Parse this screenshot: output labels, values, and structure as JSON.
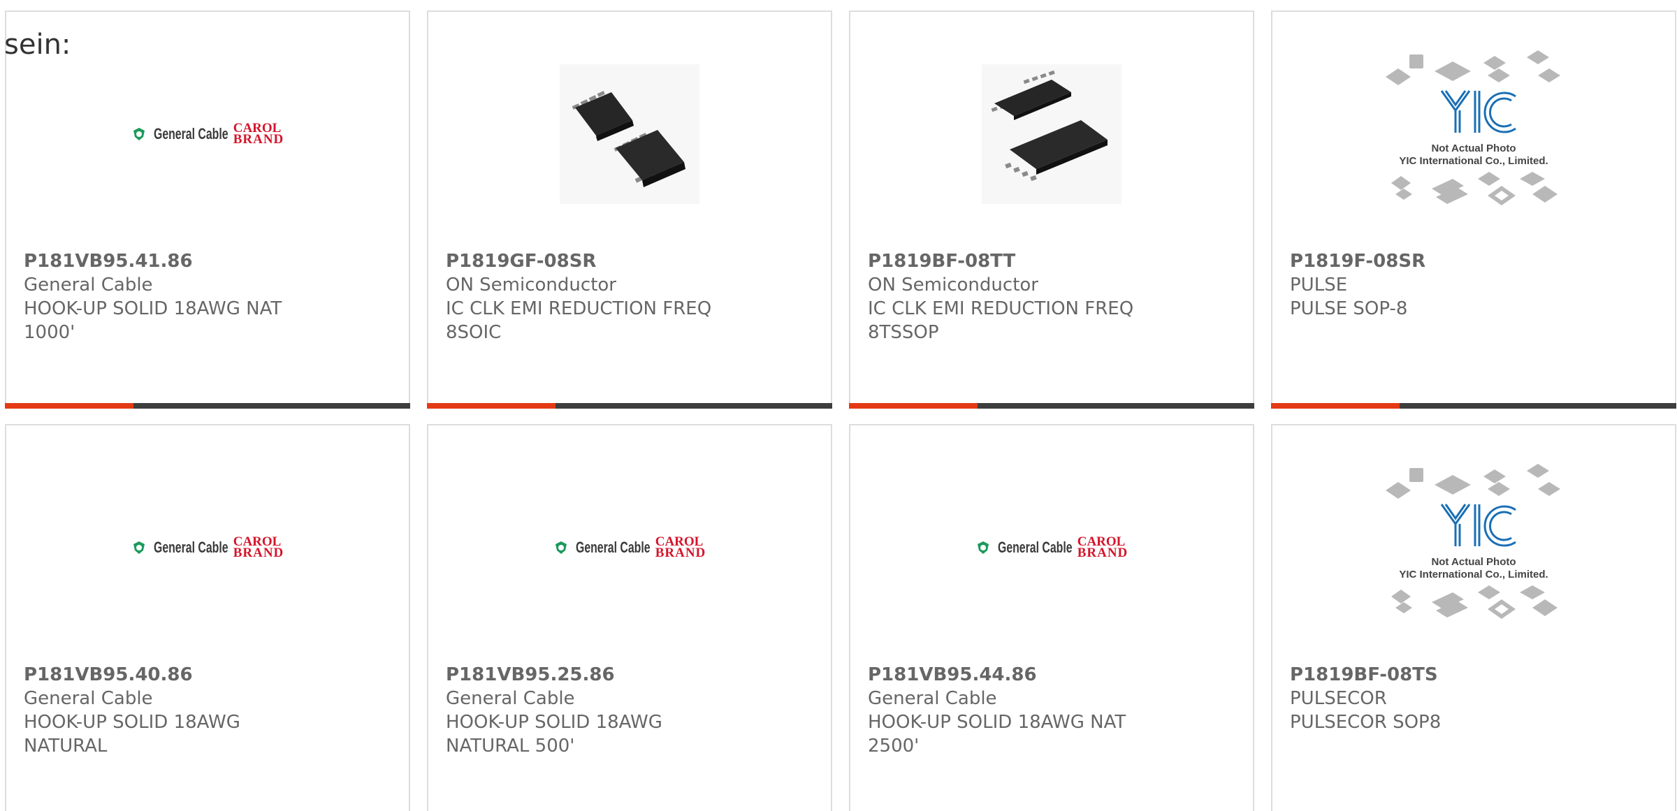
{
  "intro_text": "sein:",
  "accent_color": "#e33a14",
  "bar_color": "#3d3d3d",
  "logos": {
    "general_cable": {
      "name": "General Cable",
      "carol_line1": "CAROL",
      "carol_line2": "BRAND"
    },
    "yic": {
      "caption_line1": "Not Actual Photo",
      "caption_line2": "YIC International Co., Limited."
    }
  },
  "products": [
    {
      "part_number": "P181VB95.41.86",
      "manufacturer": "General Cable",
      "description": "HOOK-UP SOLID 18AWG NAT 1000'",
      "image": "general-cable-logo"
    },
    {
      "part_number": "P1819GF-08SR",
      "manufacturer": "ON Semiconductor",
      "description": "IC CLK EMI REDUCTION FREQ 8SOIC",
      "image": "soic-chip-photo"
    },
    {
      "part_number": "P1819BF-08TT",
      "manufacturer": "ON Semiconductor",
      "description": "IC CLK EMI REDUCTION FREQ 8TSSOP",
      "image": "tssop-chip-photo"
    },
    {
      "part_number": "P1819F-08SR",
      "manufacturer": "PULSE",
      "description": "PULSE SOP-8",
      "image": "yic-placeholder"
    },
    {
      "part_number": "P181VB95.40.86",
      "manufacturer": "General Cable",
      "description": "HOOK-UP SOLID 18AWG NATURAL",
      "image": "general-cable-logo"
    },
    {
      "part_number": "P181VB95.25.86",
      "manufacturer": "General Cable",
      "description": "HOOK-UP SOLID 18AWG NATURAL 500'",
      "image": "general-cable-logo"
    },
    {
      "part_number": "P181VB95.44.86",
      "manufacturer": "General Cable",
      "description": "HOOK-UP SOLID 18AWG NAT 2500'",
      "image": "general-cable-logo"
    },
    {
      "part_number": "P1819BF-08TS",
      "manufacturer": "PULSECOR",
      "description": "PULSECOR SOP8",
      "image": "yic-placeholder"
    }
  ]
}
